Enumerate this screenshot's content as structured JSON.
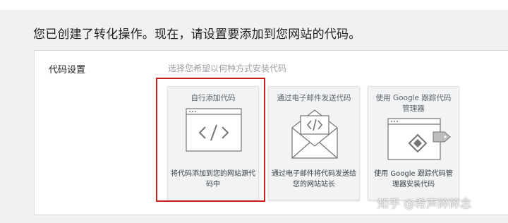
{
  "page": {
    "heading": "您已创建了转化操作。现在，请设置要添加到您网站的代码。"
  },
  "code_setup": {
    "label": "代码设置",
    "instruction": "选择您希望以何种方式安装代码",
    "options": [
      {
        "title": "自行添加代码",
        "description": "将代码添加到您的网站源代码中",
        "icon": "code-window-icon"
      },
      {
        "title": "通过电子邮件发送代码",
        "description": "通过电子邮件将代码发送给您的网站站长",
        "icon": "envelope-code-icon"
      },
      {
        "title": "使用 Google 跟踪代码管理器",
        "description": "使用 Google 跟踪代码管理器安装代码",
        "icon": "tag-manager-window-icon"
      }
    ],
    "selected_option": "自行添加代码"
  },
  "watermark": "知乎 @希声碎碎念",
  "colors": {
    "selection_border": "#c5221f",
    "card_background": "#f1f3f4",
    "icon_stroke": "#757575"
  }
}
